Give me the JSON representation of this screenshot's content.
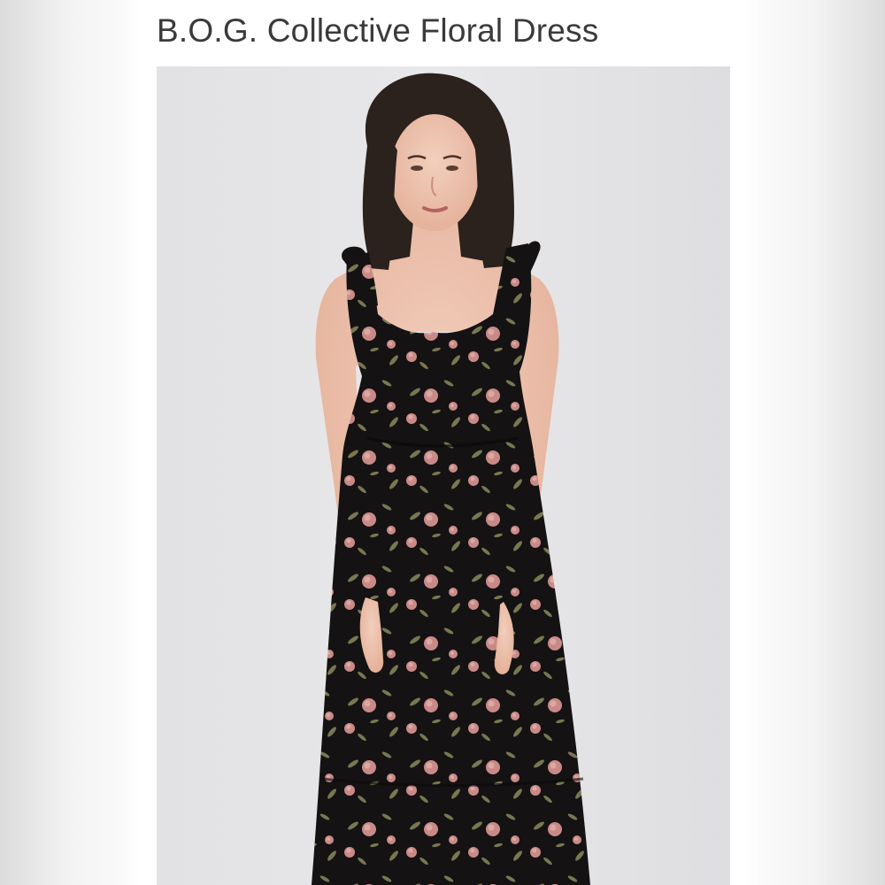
{
  "listing": {
    "title": "B.O.G. Collective Floral Dress"
  },
  "photo": {
    "subject": "product-photo-model-wearing-floral-dress",
    "background_color": "#e4e4e6",
    "dress_color": "#141213",
    "flower_color": "#c98a87",
    "leaf_color": "#8a8a5c"
  }
}
